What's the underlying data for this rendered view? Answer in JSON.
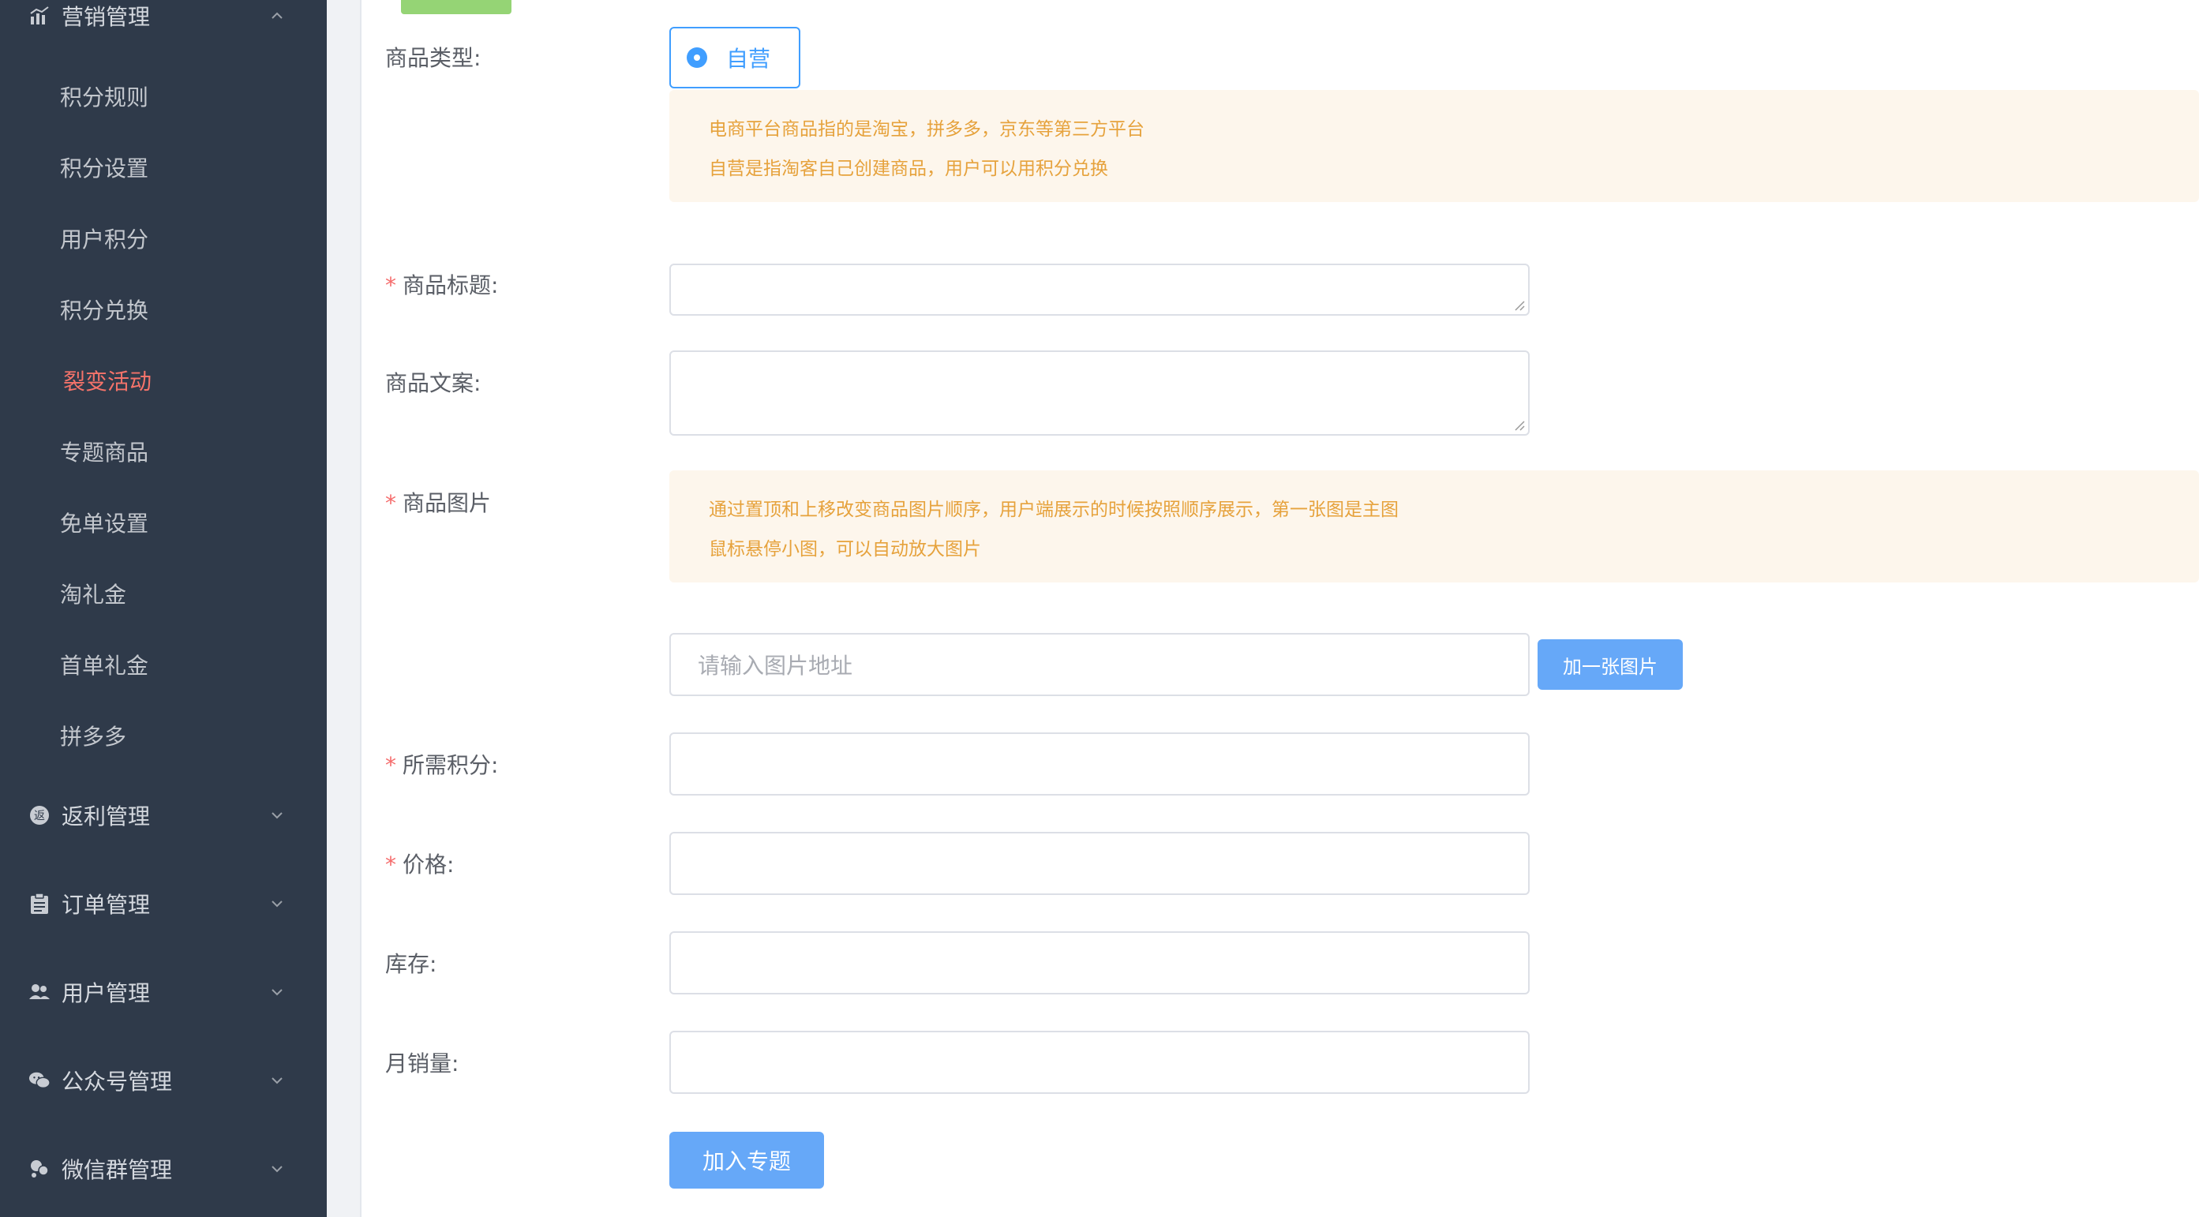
{
  "sidebar": {
    "groups": [
      {
        "label": "营销管理",
        "icon": "chart-icon",
        "expanded": true
      },
      {
        "label": "返利管理",
        "icon": "rebate-icon",
        "expanded": false
      },
      {
        "label": "订单管理",
        "icon": "clipboard-icon",
        "expanded": false
      },
      {
        "label": "用户管理",
        "icon": "users-icon",
        "expanded": false
      },
      {
        "label": "公众号管理",
        "icon": "wechat-icon",
        "expanded": false
      },
      {
        "label": "微信群管理",
        "icon": "group-chat-icon",
        "expanded": false
      }
    ],
    "sub_items": [
      {
        "label": "积分规则"
      },
      {
        "label": "积分设置"
      },
      {
        "label": "用户积分"
      },
      {
        "label": "积分兑换"
      },
      {
        "label": "裂变活动",
        "active": true
      },
      {
        "label": "专题商品"
      },
      {
        "label": "免单设置"
      },
      {
        "label": "淘礼金"
      },
      {
        "label": "首单礼金"
      },
      {
        "label": "拼多多"
      }
    ],
    "active_color": "#f5736a",
    "background": "#2f3a4a"
  },
  "form": {
    "type_label": "商品类型:",
    "type_option": "自营",
    "type_notice": [
      "电商平台商品指的是淘宝，拼多多，京东等第三方平台",
      "自营是指淘客自己创建商品，用户可以用积分兑换"
    ],
    "title_label": "商品标题:",
    "title_value": "",
    "copy_label": "商品文案:",
    "copy_value": "",
    "image_label": "商品图片",
    "image_notice": [
      "通过置顶和上移改变商品图片顺序，用户端展示的时候按照顺序展示，第一张图是主图",
      "鼠标悬停小图，可以自动放大图片"
    ],
    "image_url_placeholder": "请输入图片地址",
    "add_image_label": "加一张图片",
    "points_label": "所需积分:",
    "points_value": "",
    "price_label": "价格:",
    "price_value": "",
    "stock_label": "库存:",
    "stock_value": "",
    "monthly_sales_label": "月销量:",
    "monthly_sales_value": "",
    "submit_label": "加入专题",
    "required_mark": "*"
  },
  "colors": {
    "primary": "#409eff",
    "button": "#66a8f8",
    "warning_text": "#e6a23c",
    "warning_bg": "#fdf6ec",
    "required": "#f56c6c"
  }
}
